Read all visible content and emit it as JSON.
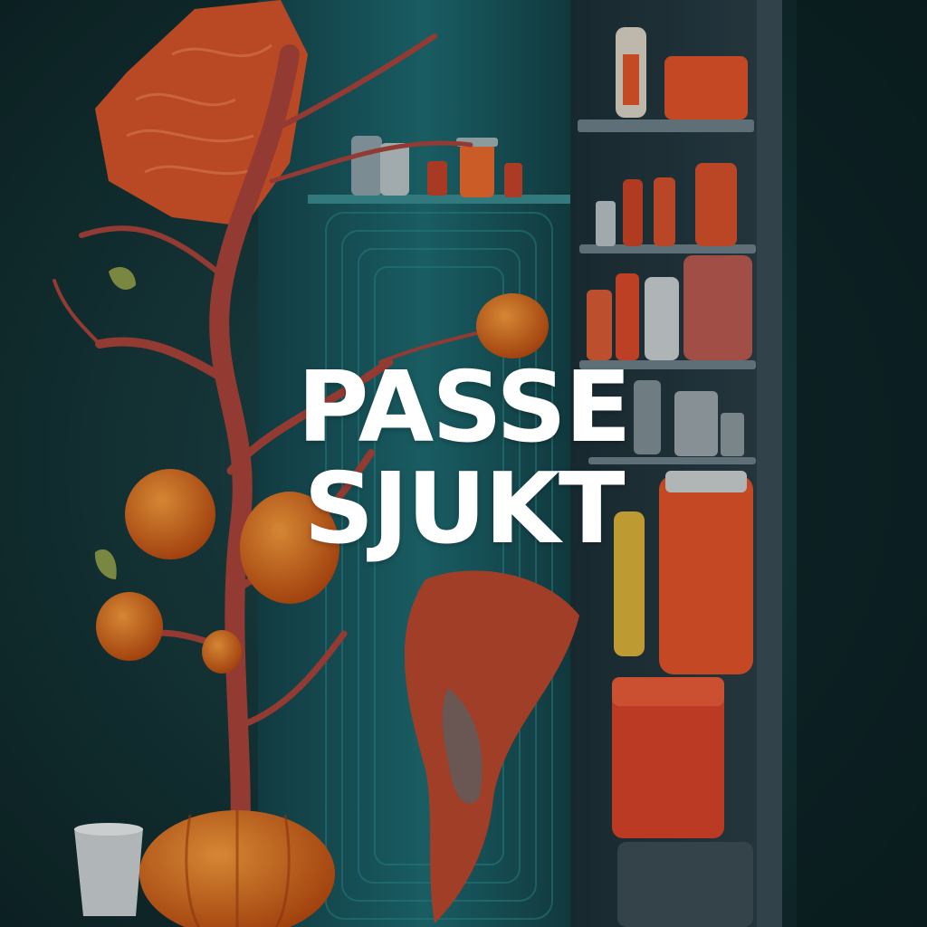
{
  "title": {
    "line1": "PASSE",
    "line2": "SJUKT"
  }
}
